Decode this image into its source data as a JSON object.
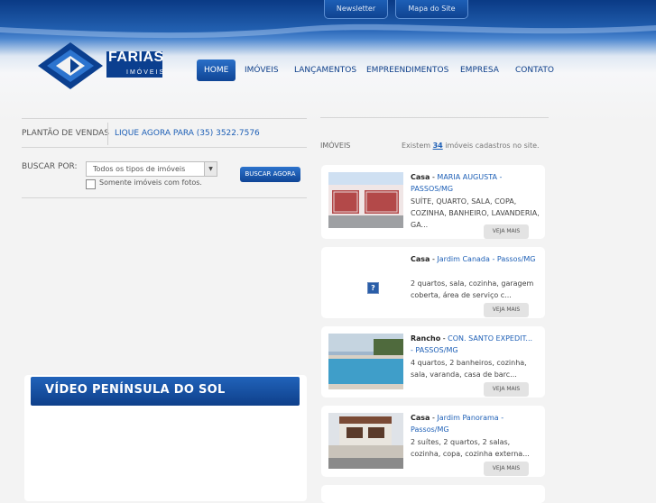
{
  "top_links": {
    "newsletter": "Newsletter",
    "sitemap": "Mapa do Site"
  },
  "logo": {
    "name": "FARIAS",
    "sub": "IMÓVEIS"
  },
  "nav": [
    "HOME",
    "IMÓVEIS",
    "LANÇAMENTOS",
    "EMPREENDIMENTOS",
    "EMPRESA",
    "CONTATO"
  ],
  "plantao": {
    "label": "PLANTÃO DE VENDAS",
    "phone": "LIQUE AGORA PARA (35) 3522.7576"
  },
  "search": {
    "label": "BUSCAR POR:",
    "select_value": "Todos os tipos de imóveis",
    "checkbox_label": "Somente imóveis com fotos.",
    "button": "BUSCAR AGORA"
  },
  "video": {
    "title": "VÍDEO PENÍNSULA DO SOL"
  },
  "imoveis": {
    "title": "IMÓVEIS",
    "count_prefix": "Existem",
    "count": "34",
    "count_suffix": "imóveis cadastros no site."
  },
  "listings": [
    {
      "type": "Casa",
      "location": "MARIA AUGUSTA - PASSOS/MG",
      "desc": "SUÍTE, QUARTO, SALA, COPA, COZINHA, BANHEIRO, LAVANDERIA, GA...",
      "cta": "VEJA MAIS"
    },
    {
      "type": "Casa",
      "location": "Jardim Canada - Passos/MG",
      "desc": "2 quartos, sala, cozinha, garagem coberta, área de serviço c...",
      "cta": "VEJA MAIS"
    },
    {
      "type": "Rancho",
      "location": "CON. SANTO EXPEDIT... - PASSOS/MG",
      "desc": "4 quartos, 2 banheiros, cozinha, sala, varanda, casa de barc...",
      "cta": "VEJA MAIS"
    },
    {
      "type": "Casa",
      "location": "Jardim Panorama - Passos/MG",
      "desc": "2 suítes, 2 quartos, 2 salas, cozinha, copa, cozinha externa...",
      "cta": "VEJA MAIS"
    }
  ],
  "colors": {
    "brand_blue": "#0e3f8a",
    "link_blue": "#1d5fb6",
    "accent_blue": "#2a6fc7"
  }
}
